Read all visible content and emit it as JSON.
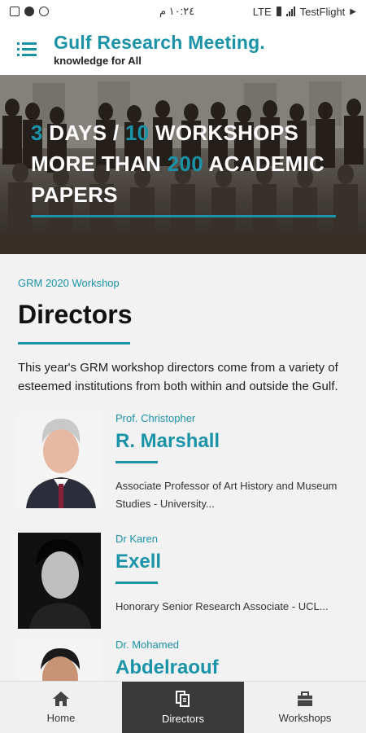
{
  "status_bar": {
    "time": "١٠:٢٤ م",
    "network": "LTE",
    "app_back": "TestFlight"
  },
  "header": {
    "title": "Gulf Research Meeting.",
    "subtitle": "knowledge for All"
  },
  "hero": {
    "days_num": "3",
    "days_label": " DAYS / ",
    "workshops_num": "10",
    "workshops_label": " WORKSHOPS",
    "more_than": "MORE THAN ",
    "papers_num": "200",
    "papers_label": " ACADEMIC",
    "papers_label2": "PAPERS"
  },
  "section": {
    "kicker": "GRM 2020 Workshop",
    "title": "Directors",
    "intro": "This year's GRM workshop directors come from a variety of esteemed institutions from both within and outside the Gulf."
  },
  "directors": [
    {
      "prefix": "Prof. Christopher",
      "name": "R. Marshall",
      "role": "Associate Professor of Art History and Museum Studies - University..."
    },
    {
      "prefix": "Dr Karen",
      "name": "Exell",
      "role": "Honorary Senior Research Associate - UCL..."
    },
    {
      "prefix": "Dr. Mohamed",
      "name": "Abdelraouf",
      "role": ""
    }
  ],
  "tabs": [
    {
      "label": "Home",
      "icon": "home-icon"
    },
    {
      "label": "Directors",
      "icon": "directors-icon"
    },
    {
      "label": "Workshops",
      "icon": "workshops-icon"
    }
  ],
  "colors": {
    "accent": "#1a93a8",
    "tab_active": "#3a3a3a"
  }
}
